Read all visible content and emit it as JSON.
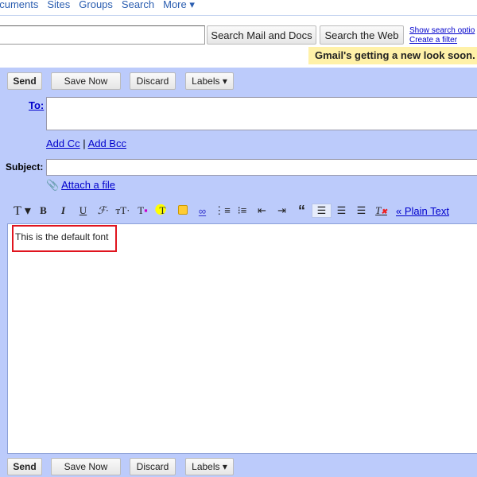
{
  "nav": {
    "items": [
      "ocuments",
      "Sites",
      "Groups",
      "Search",
      "More ▾"
    ]
  },
  "search": {
    "value": "",
    "mail_button": "Search Mail and Docs",
    "web_button": "Search the Web",
    "show_options": "Show search optio",
    "create_filter": "Create a filter"
  },
  "banner": "Gmail's getting a new look soon.",
  "compose": {
    "send": "Send",
    "save": "Save Now",
    "discard": "Discard",
    "labels": "Labels ▾",
    "to_label": "To:",
    "to_value": "",
    "add_cc": "Add Cc",
    "sep": "|",
    "add_bcc": "Add Bcc",
    "subject_label": "Subject:",
    "subject_value": "",
    "attach": "Attach a file",
    "plain_text": "« Plain Text",
    "body": "This is the default font"
  },
  "toolbar": [
    "font-icon",
    "bold-icon",
    "italic-icon",
    "underline-icon",
    "font-face-icon",
    "font-size-icon",
    "text-color-icon",
    "highlight-icon",
    "emoticon-icon",
    "link-icon",
    "numbered-list-icon",
    "bullet-list-icon",
    "indent-less-icon",
    "indent-more-icon",
    "quote-icon",
    "align-left-icon",
    "align-center-icon",
    "align-right-icon",
    "remove-formatting-icon"
  ],
  "colors": {
    "compose_bg": "#bccbfb",
    "link": "#0000cc",
    "highlight_box": "#e0141e",
    "banner": "#fff1a8"
  }
}
